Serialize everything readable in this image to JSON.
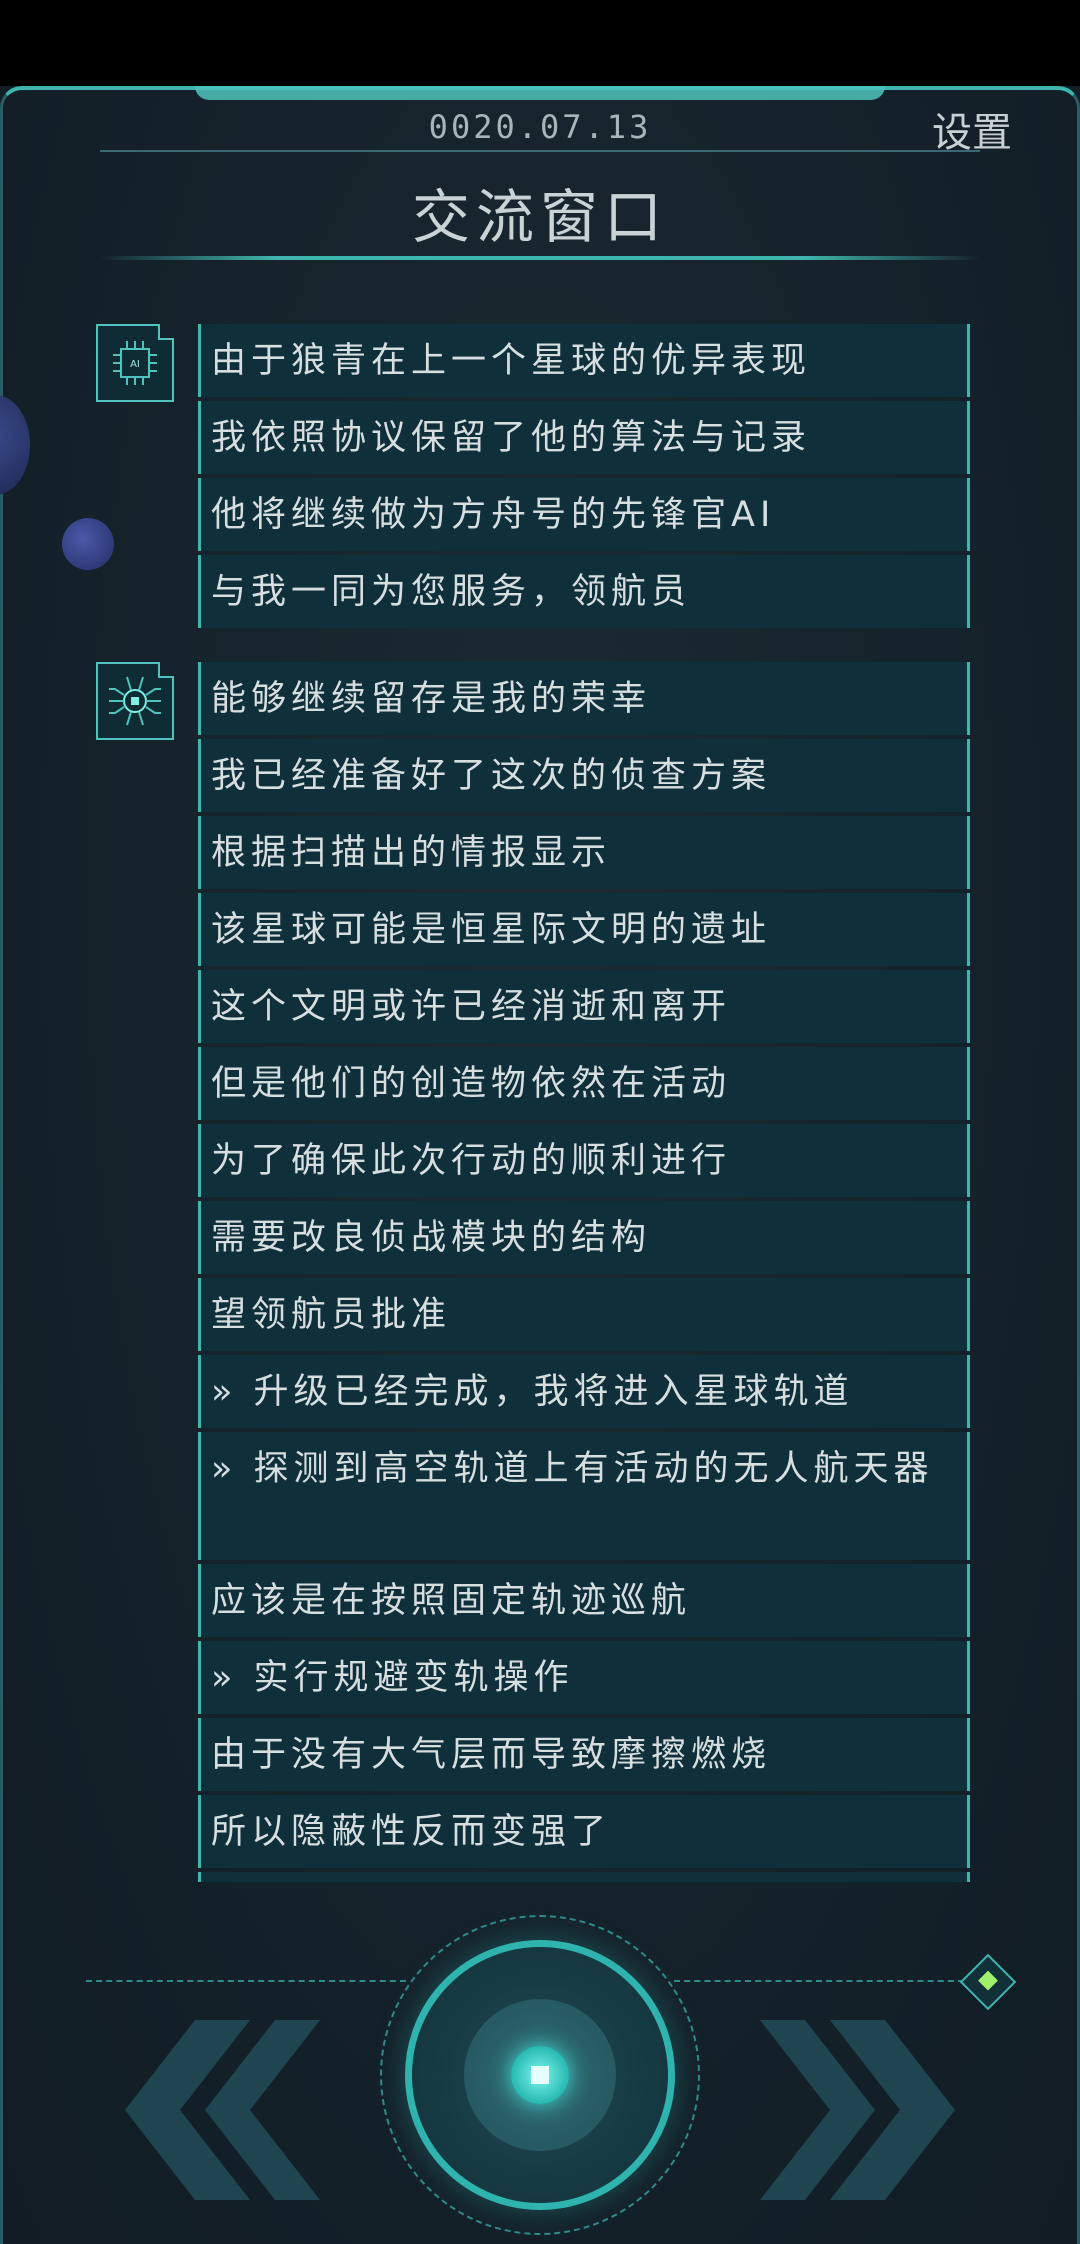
{
  "header": {
    "date": "0020.07.13",
    "settings_label": "设置",
    "title": "交流窗口"
  },
  "avatars": [
    {
      "icon": "ai-chip-icon",
      "label": "AI"
    },
    {
      "icon": "circuit-bug-icon"
    }
  ],
  "groups": [
    {
      "messages": [
        "由于狼青在上一个星球的优异表现",
        "我依照协议保留了他的算法与记录",
        "他将继续做为方舟号的先锋官AI",
        "与我一同为您服务，领航员"
      ]
    },
    {
      "messages": [
        "能够继续留存是我的荣幸",
        "我已经准备好了这次的侦查方案",
        "根据扫描出的情报显示",
        "该星球可能是恒星际文明的遗址",
        "这个文明或许已经消逝和离开",
        "但是他们的创造物依然在活动",
        "为了确保此次行动的顺利进行",
        "需要改良侦战模块的结构",
        "望领航员批准",
        "» 升级已经完成，我将进入星球轨道",
        "» 探测到高空轨道上有活动的无人航天器",
        "应该是在按照固定轨迹巡航",
        "» 实行规避变轨操作",
        "由于没有大气层而导致摩擦燃烧",
        "所以隐蔽性反而变强了"
      ]
    }
  ],
  "controls": {
    "prev_icon": "double-chevron-left-icon",
    "next_icon": "double-chevron-right-icon",
    "center_icon": "stop-square-icon",
    "corner_icon": "diamond-gem-icon"
  },
  "colors": {
    "accent": "#3fb5b0",
    "bubble": "#0f2f3b",
    "background": "#15222b",
    "text": "#d7dee0"
  }
}
